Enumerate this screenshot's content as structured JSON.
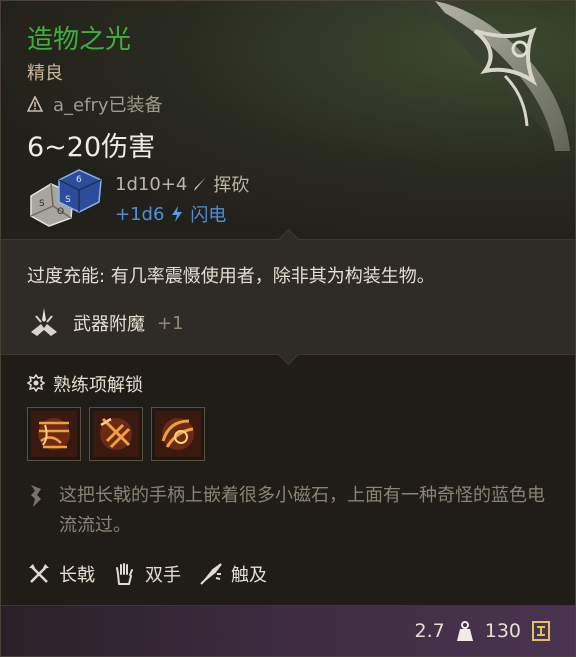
{
  "item": {
    "name": "造物之光",
    "rarity": "精良",
    "equipped_text": "a_efry已装备",
    "damage": "6~20伤害",
    "dice_line": {
      "formula": "1d10+4",
      "type": "挥砍"
    },
    "bonus_line": {
      "formula": "+1d6",
      "type": "闪电"
    }
  },
  "passive": {
    "text": "过度充能: 有几率震慑使用者，除非其为构装生物。"
  },
  "enchant": {
    "label": "武器附魔",
    "bonus": "+1"
  },
  "proficiency": {
    "title": "熟练项解锁",
    "icons": [
      "proficiency-action-1-icon",
      "proficiency-action-2-icon",
      "proficiency-action-3-icon"
    ]
  },
  "description": "这把长戟的手柄上嵌着很多小磁石，上面有一种奇怪的蓝色电流流过。",
  "properties": [
    {
      "icon": "halberd-icon",
      "label": "长戟"
    },
    {
      "icon": "two-handed-icon",
      "label": "双手"
    },
    {
      "icon": "reach-icon",
      "label": "触及"
    }
  ],
  "footer": {
    "weight": "2.7",
    "value": "130"
  },
  "colors": {
    "name": "#3fb040",
    "damage_bonus": "#4f8fd8",
    "background": "#201d18",
    "footer": "#3d2c40"
  }
}
